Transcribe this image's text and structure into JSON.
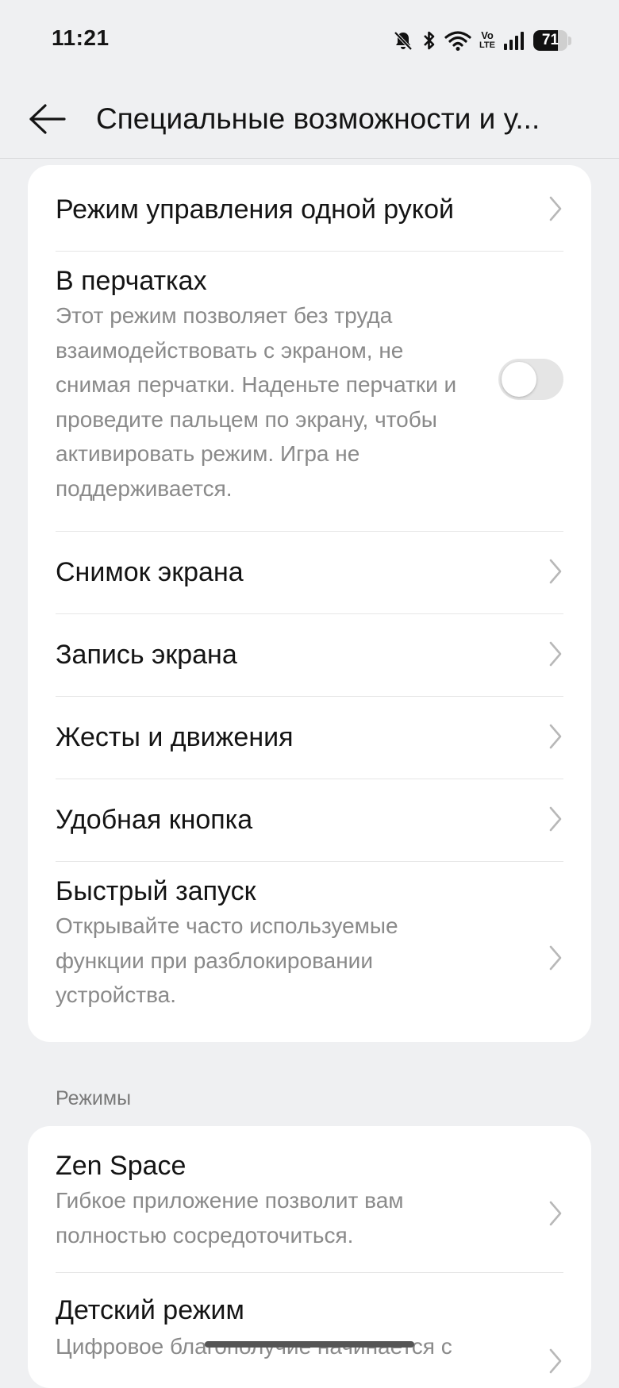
{
  "status_bar": {
    "time": "11:21",
    "icons": [
      "bell-muted-icon",
      "bluetooth-icon",
      "wifi-icon",
      "volte-icon",
      "signal-icon",
      "battery-icon"
    ],
    "volte_top": "Vo",
    "volte_bottom": "LTE",
    "battery_level": "71",
    "battery_fraction": 0.71
  },
  "header": {
    "back_icon": "arrow-left-icon",
    "title": "Специальные возможности и у..."
  },
  "card1": {
    "one_hand": {
      "title": "Режим управления одной рукой"
    },
    "gloves": {
      "title": "В перчатках",
      "desc": "Этот режим позволяет без труда взаимодействовать с экраном, не снимая перчатки. Наденьте перчатки и проведите пальцем по экрану, чтобы активировать режим. Игра не поддерживается.",
      "enabled": false
    },
    "screenshot": {
      "title": "Снимок экрана"
    },
    "screen_record": {
      "title": "Запись экрана"
    },
    "gestures": {
      "title": "Жесты и движения"
    },
    "smart_button": {
      "title": "Удобная кнопка"
    },
    "quick_launch": {
      "title": "Быстрый запуск",
      "desc": "Открывайте часто используемые функции при разблокировании устройства."
    }
  },
  "modes_section": {
    "header": "Режимы",
    "zen": {
      "title": "Zen Space",
      "desc": "Гибкое приложение позволит вам полностью сосредоточиться."
    },
    "kids": {
      "title": "Детский режим",
      "desc": "Цифровое благополучие начинается с"
    }
  },
  "colors": {
    "background": "#eff0f2",
    "card": "#ffffff",
    "text_primary": "#141414",
    "text_secondary": "#8a8a8a",
    "toggle_off": "#e5e5e5"
  }
}
